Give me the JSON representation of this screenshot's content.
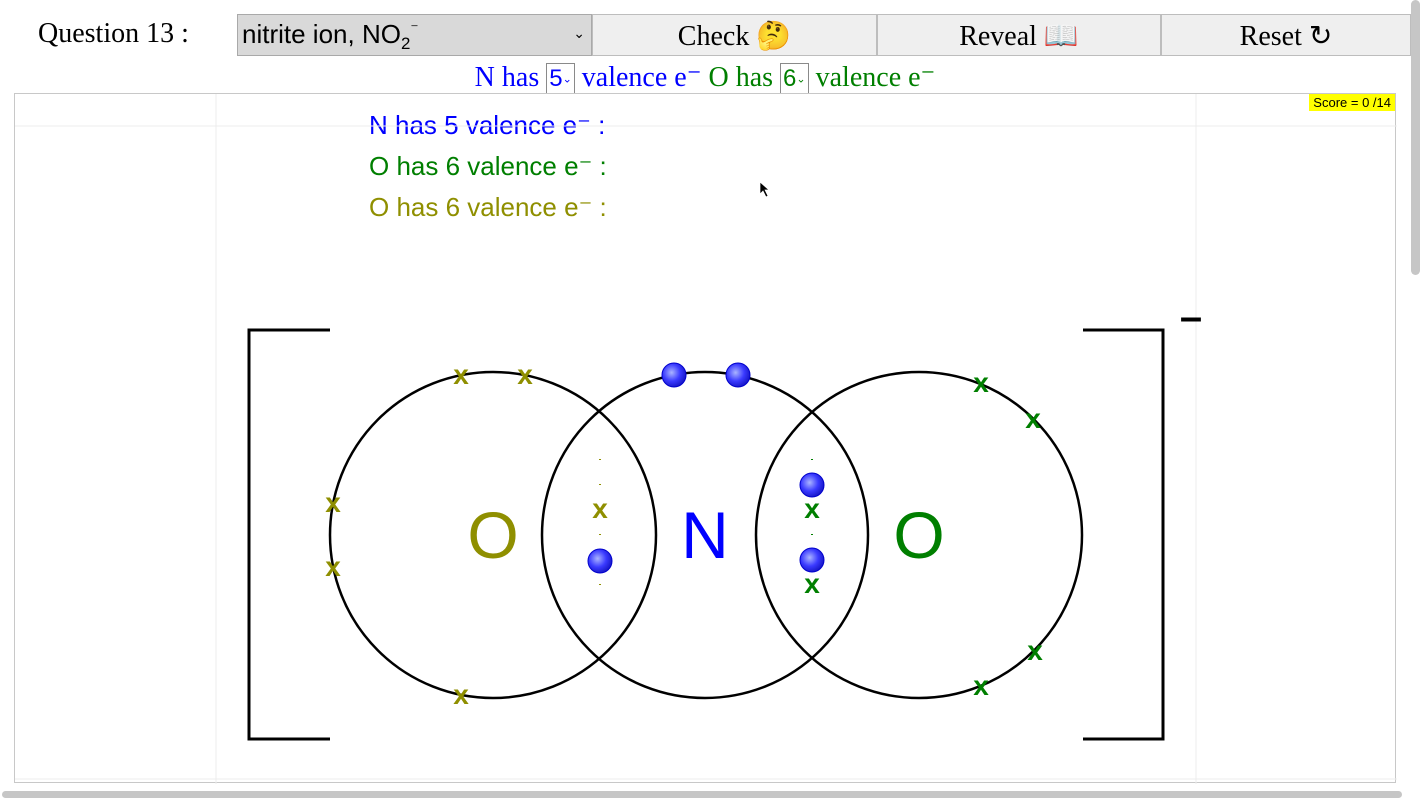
{
  "header": {
    "question_label": "Question 13 :",
    "selected_question": "nitrite ion, NO",
    "selected_sub": "2",
    "selected_sup": "⁻",
    "check_label": "Check 🤔",
    "reveal_label": "Reveal 📖",
    "reset_label": "Reset ↻"
  },
  "selectors": {
    "n_prefix": "N has",
    "n_value": "5",
    "o_prefix": "O has",
    "o_value": "6",
    "suffix": "valence e⁻"
  },
  "canvas": {
    "score": "Score = 0 /14",
    "info_lines": [
      "N has 5 valence e⁻ :",
      "O has 6 valence e⁻ :",
      "O has 6 valence e⁻ :"
    ],
    "charge": "–",
    "atoms": [
      {
        "symbol": "O",
        "color": "#8f8f00"
      },
      {
        "symbol": "N",
        "color": "#0000ff"
      },
      {
        "symbol": "O",
        "color": "#007f00"
      }
    ],
    "electron_marker": "x",
    "colors": {
      "nitrogen": "#0000ff",
      "oxygen_left": "#8f8f00",
      "oxygen_right": "#007f00"
    }
  }
}
